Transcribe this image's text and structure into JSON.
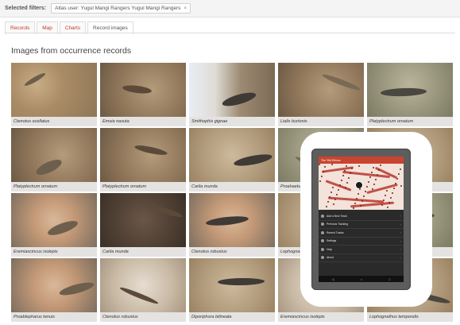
{
  "filters": {
    "label": "Selected filters:",
    "chip": "Atlas user: Yugul Mangi Rangers Yugul Mangi Rangers",
    "chip_close": "×"
  },
  "tabs": [
    {
      "label": "Records"
    },
    {
      "label": "Map"
    },
    {
      "label": "Charts"
    },
    {
      "label": "Record images"
    }
  ],
  "section_title": "Images from occurrence records",
  "tiles": [
    {
      "caption": "Ctenotus ocellatus",
      "texture": "soil"
    },
    {
      "caption": "Emoia nasuta",
      "texture": "leaf"
    },
    {
      "caption": "Smithophis gignae",
      "texture": "sky"
    },
    {
      "caption": "Lialis burtonis",
      "texture": "leaf"
    },
    {
      "caption": "Platyplectrum ornatum",
      "texture": "grass"
    },
    {
      "caption": "Platyplectrum ornatum",
      "texture": "leaf"
    },
    {
      "caption": "Platyplectrum ornatum",
      "texture": "leaf"
    },
    {
      "caption": "Carlia munda",
      "texture": "sand"
    },
    {
      "caption": "Proahaetulla",
      "texture": "grass"
    },
    {
      "caption": "",
      "texture": "sand"
    },
    {
      "caption": "Eremiascincus isolepis",
      "texture": "hand"
    },
    {
      "caption": "Carlia munda",
      "texture": "dark"
    },
    {
      "caption": "Ctenotus robustus",
      "texture": "hand"
    },
    {
      "caption": "Lophognathus",
      "texture": "sand"
    },
    {
      "caption": "",
      "texture": "grass"
    },
    {
      "caption": "Proablepharus tenuis",
      "texture": "hand"
    },
    {
      "caption": "Ctenotus robustus",
      "texture": "light"
    },
    {
      "caption": "Diporiphora bilineata",
      "texture": "sand"
    },
    {
      "caption": "Eremiascincus isolepis",
      "texture": "light"
    },
    {
      "caption": "Lophognathus temporalis",
      "texture": "sand"
    }
  ],
  "tablet": {
    "app_title": "The Yitti Ethnos",
    "menu": [
      {
        "label": "Add a New Track"
      },
      {
        "label": "Previous Tracking"
      },
      {
        "label": "Recent Tracks"
      },
      {
        "label": "Settings"
      },
      {
        "label": "Help"
      },
      {
        "label": "About"
      }
    ],
    "nav": [
      "◁",
      "○",
      "□"
    ],
    "accent": "#c9442f"
  }
}
